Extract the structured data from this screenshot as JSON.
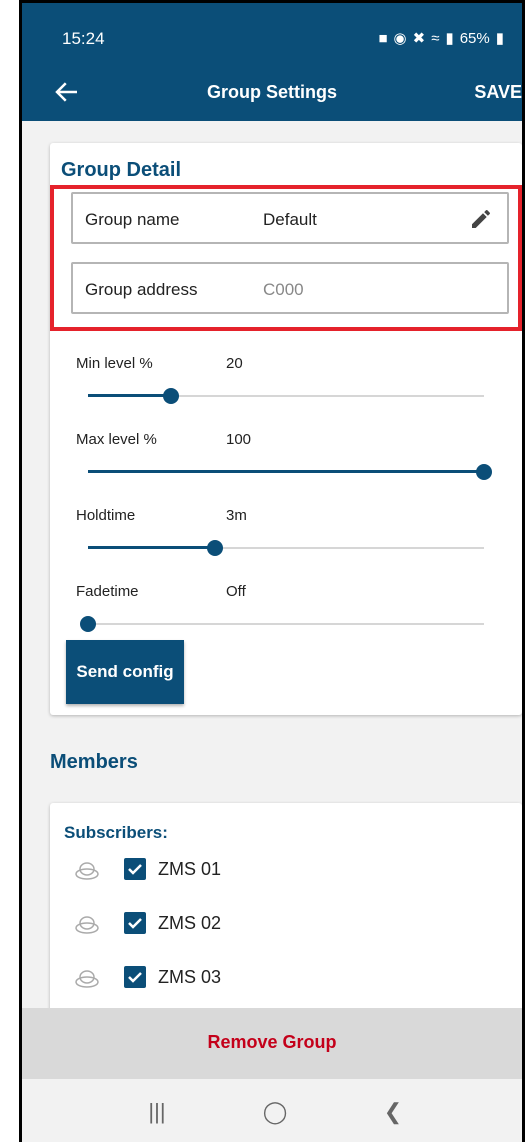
{
  "status": {
    "time": "15:24",
    "battery": "65%"
  },
  "appbar": {
    "title": "Group Settings",
    "save_label": "SAVE"
  },
  "group_detail": {
    "title": "Group Detail",
    "name_label": "Group name",
    "name_value": "Default",
    "address_label": "Group address",
    "address_value": "C000"
  },
  "sliders": [
    {
      "label": "Min level %",
      "value": "20",
      "fraction": 0.21
    },
    {
      "label": "Max level %",
      "value": "100",
      "fraction": 1.0
    },
    {
      "label": "Holdtime",
      "value": "3m",
      "fraction": 0.32
    },
    {
      "label": "Fadetime",
      "value": "Off",
      "fraction": 0.0
    }
  ],
  "send_config_label": "Send config",
  "members": {
    "title": "Members",
    "subscribers_title": "Subscribers:",
    "subscribers": [
      {
        "label": "ZMS 01",
        "checked": true
      },
      {
        "label": "ZMS 02",
        "checked": true
      },
      {
        "label": "ZMS 03",
        "checked": true
      }
    ]
  },
  "remove_group_label": "Remove Group",
  "colors": {
    "primary": "#0b4e78",
    "highlight": "#e5222b",
    "danger": "#c4001a"
  }
}
